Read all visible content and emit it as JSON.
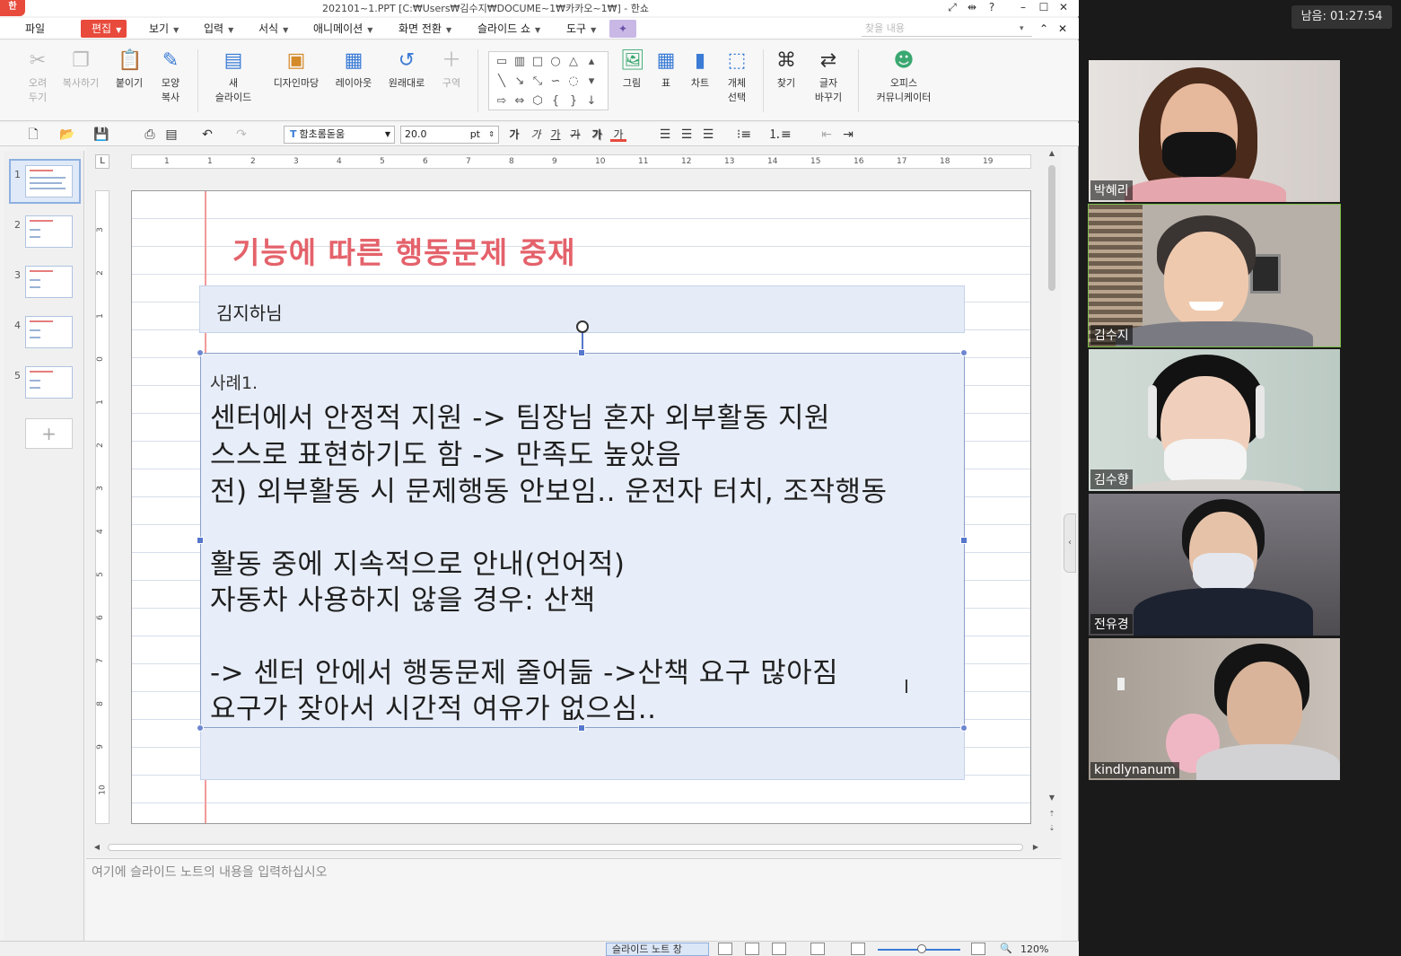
{
  "app": {
    "logo_text": "한",
    "window_title": "202101~1.PPT [C:₩Users₩김수지₩DOCUME~1₩카카오~1₩] - 한쇼",
    "window_controls": {
      "fullscreen": "⤢",
      "layout": "⇹",
      "help": "?",
      "minimize": "–",
      "maximize": "☐",
      "close": "✕"
    }
  },
  "menu": {
    "items": [
      {
        "label": "파일",
        "has_arrow": false
      },
      {
        "label": "편집",
        "has_arrow": true,
        "selected": true
      },
      {
        "label": "보기",
        "has_arrow": true
      },
      {
        "label": "입력",
        "has_arrow": true
      },
      {
        "label": "서식",
        "has_arrow": true
      },
      {
        "label": "애니메이션",
        "has_arrow": true
      },
      {
        "label": "화면 전환",
        "has_arrow": true
      },
      {
        "label": "슬라이드 쇼",
        "has_arrow": true
      },
      {
        "label": "도구",
        "has_arrow": true
      }
    ],
    "find_placeholder": "찾을 내용",
    "find_arrow": "▾",
    "collapse": "⌃",
    "close": "✕"
  },
  "ribbon": {
    "cut": {
      "line1": "오려",
      "line2": "두기"
    },
    "copy": {
      "line1": "복사하기",
      "line2": ""
    },
    "paste": {
      "line1": "붙이기",
      "line2": ""
    },
    "format_copy": {
      "line1": "모양",
      "line2": "복사"
    },
    "new_slide": {
      "line1": "새",
      "line2": "슬라이드"
    },
    "design_store": {
      "line1": "디자인마당",
      "line2": ""
    },
    "layout": {
      "line1": "레이아웃",
      "line2": ""
    },
    "reset": {
      "line1": "원래대로",
      "line2": ""
    },
    "section": {
      "line1": "구역",
      "line2": ""
    },
    "picture": {
      "line1": "그림",
      "line2": ""
    },
    "table": {
      "line1": "표",
      "line2": ""
    },
    "chart": {
      "line1": "차트",
      "line2": ""
    },
    "select_object": {
      "line1": "개체",
      "line2": "선택"
    },
    "find": {
      "line1": "찾기",
      "line2": ""
    },
    "replace": {
      "line1": "글자",
      "line2": "바꾸기"
    },
    "office_communicator": {
      "line1": "오피스",
      "line2": "커뮤니케이터"
    }
  },
  "toolbar": {
    "font_name": "함초롬돋움",
    "font_size": "20.0",
    "font_unit": "pt",
    "bold": "가",
    "italic": "가",
    "underline": "가",
    "strike": "가",
    "shadow": "가",
    "color": "가"
  },
  "ruler": {
    "h_ticks": [
      "1",
      "1",
      "2",
      "3",
      "4",
      "5",
      "6",
      "7",
      "8",
      "9",
      "10",
      "11",
      "12",
      "13",
      "14",
      "15",
      "16",
      "17",
      "18",
      "19"
    ],
    "v_ticks": [
      "3",
      "2",
      "1",
      "0",
      "1",
      "2",
      "3",
      "4",
      "5",
      "6",
      "7",
      "8",
      "9",
      "10"
    ],
    "corner": "L"
  },
  "thumbnails": {
    "numbers": [
      "1",
      "2",
      "3",
      "4",
      "5"
    ],
    "selected": 1,
    "add_label": "+"
  },
  "slide": {
    "title": "기능에 따른 행동문제 중재",
    "subtitle": "김지하님",
    "case_label": "사례1.",
    "body_lines": [
      "센터에서 안정적 지원 -> 팀장님 혼자 외부활동 지원",
      "스스로 표현하기도 함 -> 만족도 높았음",
      "전) 외부활동 시 문제행동 안보임.. 운전자 터치, 조작행동",
      "",
      "활동 중에 지속적으로 안내(언어적)",
      "자동차 사용하지 않을 경우: 산책",
      "",
      "-> 센터 안에서 행동문제 줄어듦 ->산책 요구 많아짐",
      "요구가 잦아서 시간적 여유가 없으심.."
    ]
  },
  "notes": {
    "placeholder": "여기에 슬라이드 노트의 내용을 입력하십시오"
  },
  "status": {
    "note_view": "슬라이드 노트 창",
    "zoom": "120%"
  },
  "video_call": {
    "remaining_time": "남음: 01:27:54",
    "participants": [
      {
        "name": "박혜리",
        "active": false
      },
      {
        "name": "김수지",
        "active": true
      },
      {
        "name": "김수향",
        "active": false
      },
      {
        "name": "전유경",
        "active": false
      },
      {
        "name": "kindlynanum",
        "active": false
      }
    ]
  }
}
